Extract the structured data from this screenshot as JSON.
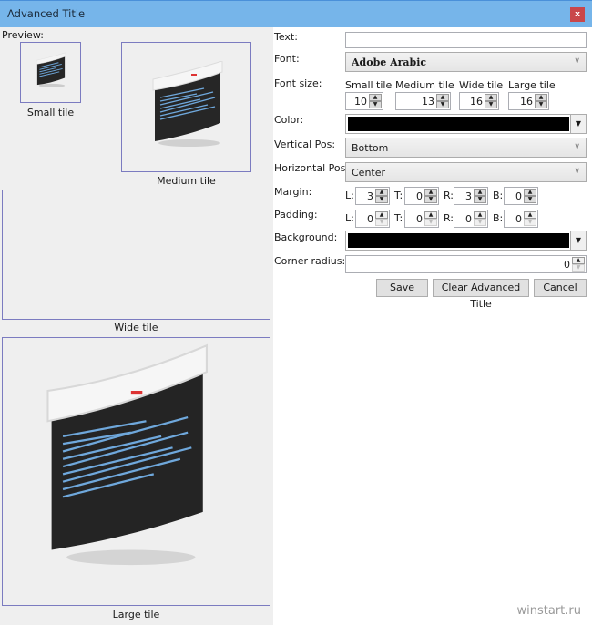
{
  "window": {
    "title": "Advanced Title",
    "close_icon": "close-icon"
  },
  "preview": {
    "label": "Preview:",
    "tiles": {
      "small": {
        "caption": "Small tile",
        "icon": "terminal-console-icon"
      },
      "medium": {
        "caption": "Medium tile",
        "icon": "terminal-console-icon"
      },
      "wide": {
        "caption": "Wide tile"
      },
      "large": {
        "caption": "Large tile",
        "icon": "terminal-console-icon"
      }
    }
  },
  "form": {
    "text": {
      "label": "Text:",
      "value": ""
    },
    "font": {
      "label": "Font:",
      "value": "Adobe Arabic"
    },
    "font_size": {
      "label": "Font size:",
      "small": {
        "label": "Small tile",
        "value": "10"
      },
      "medium": {
        "label": "Medium tile",
        "value": "13"
      },
      "wide": {
        "label": "Wide tile",
        "value": "16"
      },
      "large": {
        "label": "Large tile",
        "value": "16"
      }
    },
    "color": {
      "label": "Color:",
      "value": "#000000"
    },
    "vertical_pos": {
      "label": "Vertical Pos:",
      "value": "Bottom"
    },
    "horizontal_pos": {
      "label": "Horizontal Pos:",
      "value": "Center"
    },
    "margin": {
      "label": "Margin:",
      "L": {
        "label": "L:",
        "value": "3"
      },
      "T": {
        "label": "T:",
        "value": "0"
      },
      "R": {
        "label": "R:",
        "value": "3"
      },
      "B": {
        "label": "B:",
        "value": "0"
      }
    },
    "padding": {
      "label": "Padding:",
      "L": {
        "label": "L:",
        "value": "0"
      },
      "T": {
        "label": "T:",
        "value": "0"
      },
      "R": {
        "label": "R:",
        "value": "0"
      },
      "B": {
        "label": "B:",
        "value": "0"
      }
    },
    "background": {
      "label": "Background:",
      "value": "transparent"
    },
    "corner_radius": {
      "label": "Corner radius:",
      "value": "0"
    }
  },
  "buttons": {
    "save": "Save",
    "clear": "Clear Advanced Title",
    "cancel": "Cancel"
  },
  "glyphs": {
    "close": "x",
    "chevron": "∨",
    "dropdown": "▼",
    "up": "▲",
    "down": "▼"
  },
  "watermark": "winstart.ru"
}
